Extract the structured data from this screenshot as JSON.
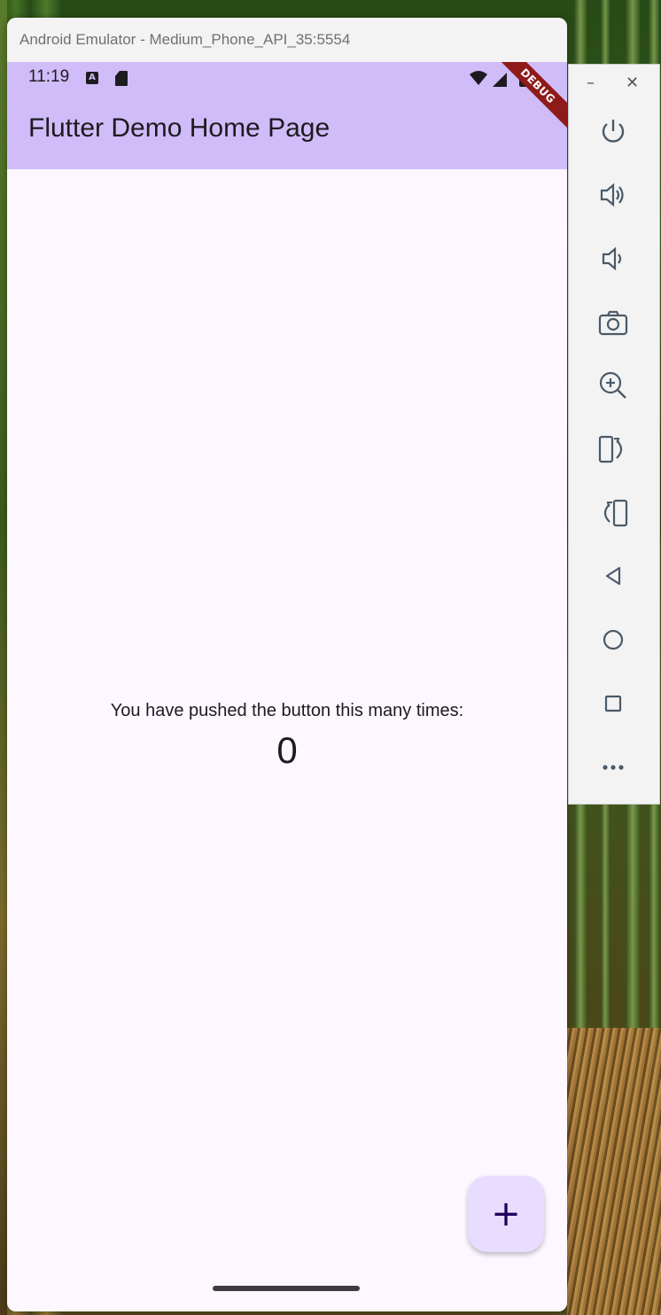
{
  "window": {
    "title": "Android Emulator - Medium_Phone_API_35:5554"
  },
  "status_bar": {
    "time": "11:19",
    "notification_a": "A"
  },
  "app_bar": {
    "title": "Flutter Demo Home Page",
    "debug_banner": "DEBUG",
    "background_color": "#d0bcf8"
  },
  "body": {
    "counter_label": "You have pushed the button this many times:",
    "counter_value": "0"
  },
  "fab": {
    "label": "+",
    "icon": "add-icon",
    "background_color": "#e9ddff"
  },
  "toolbar": {
    "minimize": "–",
    "close": "✕",
    "buttons": [
      {
        "name": "power-icon"
      },
      {
        "name": "volume-up-icon"
      },
      {
        "name": "volume-down-icon"
      },
      {
        "name": "camera-icon"
      },
      {
        "name": "zoom-icon"
      },
      {
        "name": "rotate-left-icon"
      },
      {
        "name": "rotate-right-icon"
      },
      {
        "name": "back-icon"
      },
      {
        "name": "home-icon"
      },
      {
        "name": "overview-icon"
      },
      {
        "name": "more-icon"
      }
    ]
  }
}
